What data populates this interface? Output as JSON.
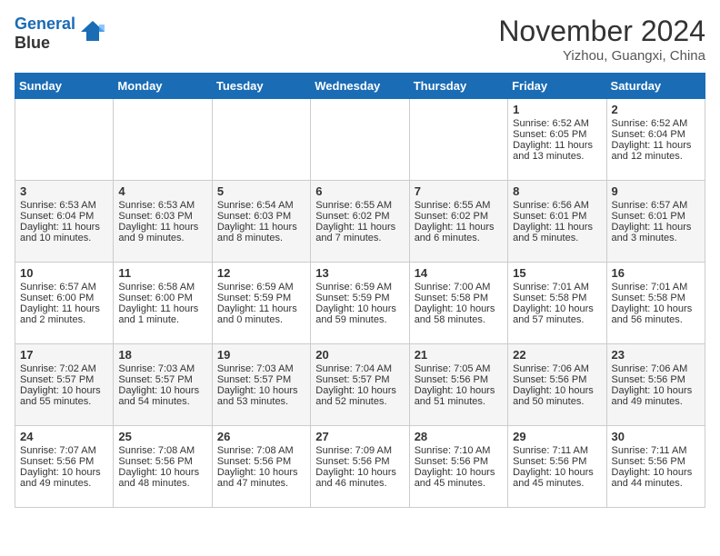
{
  "header": {
    "logo_line1": "General",
    "logo_line2": "Blue",
    "month_title": "November 2024",
    "location": "Yizhou, Guangxi, China"
  },
  "days_of_week": [
    "Sunday",
    "Monday",
    "Tuesday",
    "Wednesday",
    "Thursday",
    "Friday",
    "Saturday"
  ],
  "weeks": [
    [
      {
        "day": "",
        "info": ""
      },
      {
        "day": "",
        "info": ""
      },
      {
        "day": "",
        "info": ""
      },
      {
        "day": "",
        "info": ""
      },
      {
        "day": "",
        "info": ""
      },
      {
        "day": "1",
        "info": "Sunrise: 6:52 AM\nSunset: 6:05 PM\nDaylight: 11 hours\nand 13 minutes."
      },
      {
        "day": "2",
        "info": "Sunrise: 6:52 AM\nSunset: 6:04 PM\nDaylight: 11 hours\nand 12 minutes."
      }
    ],
    [
      {
        "day": "3",
        "info": "Sunrise: 6:53 AM\nSunset: 6:04 PM\nDaylight: 11 hours\nand 10 minutes."
      },
      {
        "day": "4",
        "info": "Sunrise: 6:53 AM\nSunset: 6:03 PM\nDaylight: 11 hours\nand 9 minutes."
      },
      {
        "day": "5",
        "info": "Sunrise: 6:54 AM\nSunset: 6:03 PM\nDaylight: 11 hours\nand 8 minutes."
      },
      {
        "day": "6",
        "info": "Sunrise: 6:55 AM\nSunset: 6:02 PM\nDaylight: 11 hours\nand 7 minutes."
      },
      {
        "day": "7",
        "info": "Sunrise: 6:55 AM\nSunset: 6:02 PM\nDaylight: 11 hours\nand 6 minutes."
      },
      {
        "day": "8",
        "info": "Sunrise: 6:56 AM\nSunset: 6:01 PM\nDaylight: 11 hours\nand 5 minutes."
      },
      {
        "day": "9",
        "info": "Sunrise: 6:57 AM\nSunset: 6:01 PM\nDaylight: 11 hours\nand 3 minutes."
      }
    ],
    [
      {
        "day": "10",
        "info": "Sunrise: 6:57 AM\nSunset: 6:00 PM\nDaylight: 11 hours\nand 2 minutes."
      },
      {
        "day": "11",
        "info": "Sunrise: 6:58 AM\nSunset: 6:00 PM\nDaylight: 11 hours\nand 1 minute."
      },
      {
        "day": "12",
        "info": "Sunrise: 6:59 AM\nSunset: 5:59 PM\nDaylight: 11 hours\nand 0 minutes."
      },
      {
        "day": "13",
        "info": "Sunrise: 6:59 AM\nSunset: 5:59 PM\nDaylight: 10 hours\nand 59 minutes."
      },
      {
        "day": "14",
        "info": "Sunrise: 7:00 AM\nSunset: 5:58 PM\nDaylight: 10 hours\nand 58 minutes."
      },
      {
        "day": "15",
        "info": "Sunrise: 7:01 AM\nSunset: 5:58 PM\nDaylight: 10 hours\nand 57 minutes."
      },
      {
        "day": "16",
        "info": "Sunrise: 7:01 AM\nSunset: 5:58 PM\nDaylight: 10 hours\nand 56 minutes."
      }
    ],
    [
      {
        "day": "17",
        "info": "Sunrise: 7:02 AM\nSunset: 5:57 PM\nDaylight: 10 hours\nand 55 minutes."
      },
      {
        "day": "18",
        "info": "Sunrise: 7:03 AM\nSunset: 5:57 PM\nDaylight: 10 hours\nand 54 minutes."
      },
      {
        "day": "19",
        "info": "Sunrise: 7:03 AM\nSunset: 5:57 PM\nDaylight: 10 hours\nand 53 minutes."
      },
      {
        "day": "20",
        "info": "Sunrise: 7:04 AM\nSunset: 5:57 PM\nDaylight: 10 hours\nand 52 minutes."
      },
      {
        "day": "21",
        "info": "Sunrise: 7:05 AM\nSunset: 5:56 PM\nDaylight: 10 hours\nand 51 minutes."
      },
      {
        "day": "22",
        "info": "Sunrise: 7:06 AM\nSunset: 5:56 PM\nDaylight: 10 hours\nand 50 minutes."
      },
      {
        "day": "23",
        "info": "Sunrise: 7:06 AM\nSunset: 5:56 PM\nDaylight: 10 hours\nand 49 minutes."
      }
    ],
    [
      {
        "day": "24",
        "info": "Sunrise: 7:07 AM\nSunset: 5:56 PM\nDaylight: 10 hours\nand 49 minutes."
      },
      {
        "day": "25",
        "info": "Sunrise: 7:08 AM\nSunset: 5:56 PM\nDaylight: 10 hours\nand 48 minutes."
      },
      {
        "day": "26",
        "info": "Sunrise: 7:08 AM\nSunset: 5:56 PM\nDaylight: 10 hours\nand 47 minutes."
      },
      {
        "day": "27",
        "info": "Sunrise: 7:09 AM\nSunset: 5:56 PM\nDaylight: 10 hours\nand 46 minutes."
      },
      {
        "day": "28",
        "info": "Sunrise: 7:10 AM\nSunset: 5:56 PM\nDaylight: 10 hours\nand 45 minutes."
      },
      {
        "day": "29",
        "info": "Sunrise: 7:11 AM\nSunset: 5:56 PM\nDaylight: 10 hours\nand 45 minutes."
      },
      {
        "day": "30",
        "info": "Sunrise: 7:11 AM\nSunset: 5:56 PM\nDaylight: 10 hours\nand 44 minutes."
      }
    ]
  ]
}
